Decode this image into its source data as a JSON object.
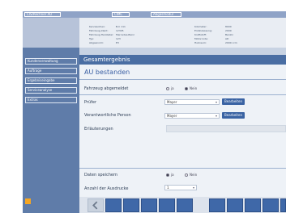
{
  "top_tabs": [
    "CIS/Rechner AU",
    "CIMC",
    "Abgasmodul"
  ],
  "sidebar": {
    "items": [
      "Kundenverwaltung",
      "Auftrage",
      "Ergebniseingabe",
      "Serviceanalyse",
      "Extras"
    ]
  },
  "info": {
    "left_labels": [
      "Kennzeichen:",
      "Fahrzeug-Ident:",
      "Fahrzeug-Hersteller:",
      "Typ:",
      "Abgasnorm:"
    ],
    "left_values": [
      "B-C 111",
      "12345",
      "Mercedes-Benz",
      "123",
      "E3"
    ],
    "right_labels": [
      "Kilometer:",
      "Erstzulassung:",
      "Kraftstoff:",
      "Motorcode:",
      "Hubraum:"
    ],
    "right_values": [
      "8000",
      "2009",
      "Benzin",
      "AD",
      "2000 ccm"
    ]
  },
  "section_title": "Gesamtergebnis",
  "status_title": "AU bestanden",
  "form": {
    "fahrzeug_label": "Fahrzeug abgemeldet",
    "fahrzeug_options": [
      "ja",
      "Nein"
    ],
    "pruefer_label": "Prüfer",
    "pruefer_value": "Mayer",
    "pruefer_button": "Bearbeiten",
    "verantwortlich_label": "Verantwortliche Person",
    "verantwortlich_value": "Mayer",
    "verantwortlich_button": "Bearbeiten",
    "erlaeuterungen_label": "Erläuterungen",
    "daten_label": "Daten speichern",
    "daten_options": [
      "ja",
      "Nein"
    ],
    "ausdrucke_label": "Anzahl der Ausdrucke",
    "ausdrucke_value": "1"
  },
  "colors": {
    "topbar": "#8fa3c7",
    "sidebar": "#5f7ca9",
    "section_bar": "#4a6ea3",
    "status_text": "#3a5fa3",
    "buttons": "#3a63a3",
    "accent_orange": "#f5a623"
  }
}
